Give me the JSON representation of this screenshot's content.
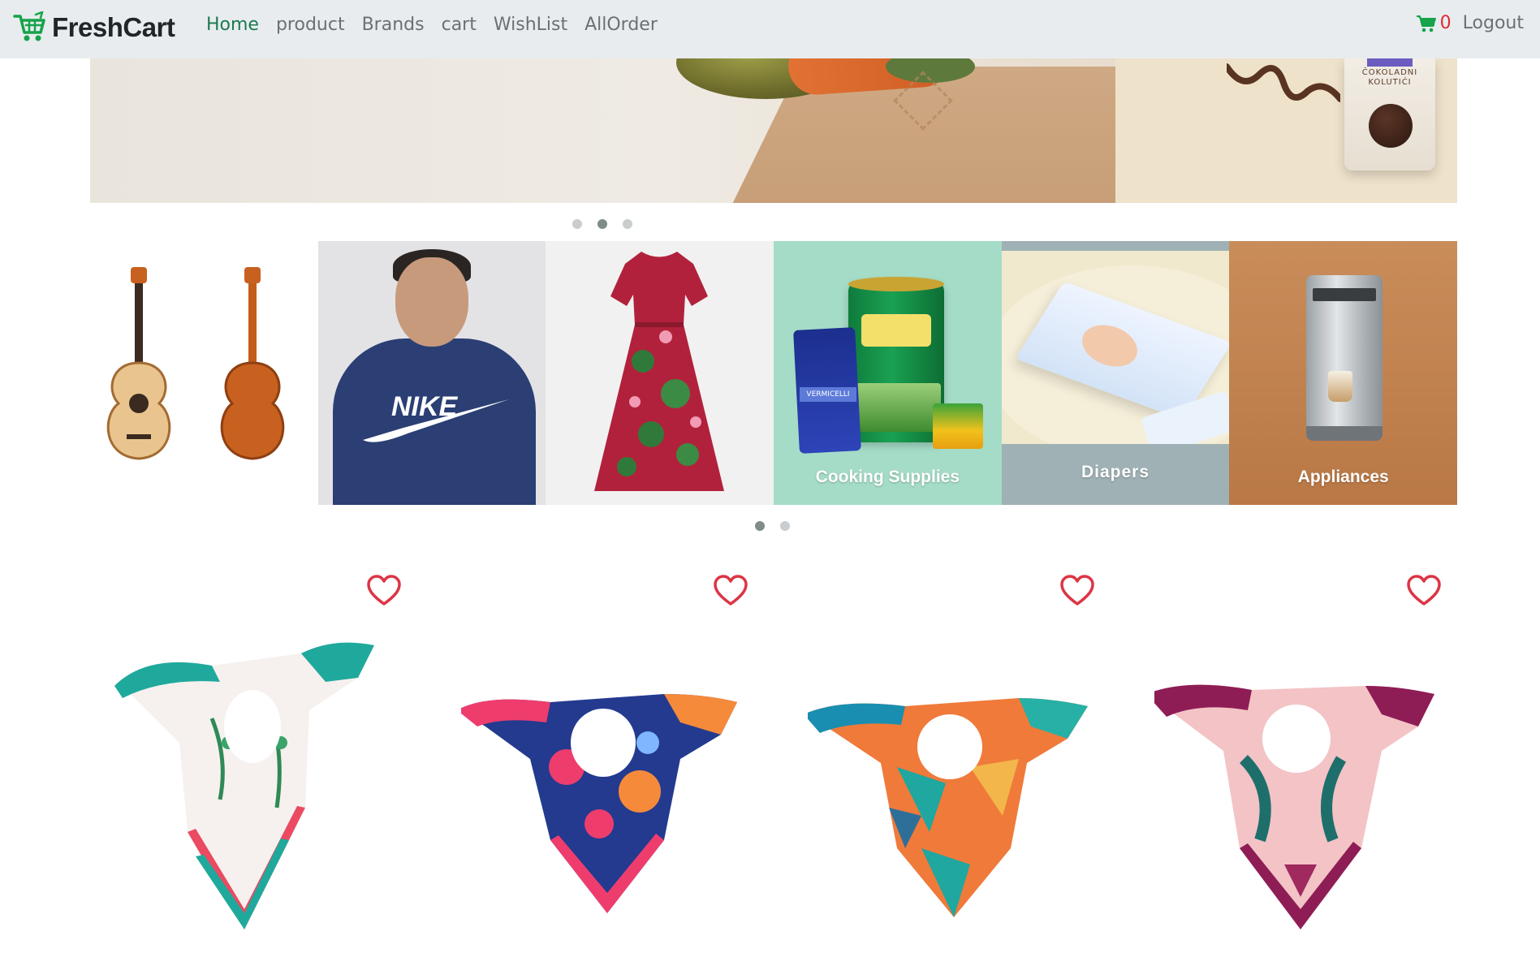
{
  "navbar": {
    "brand": "FreshCart",
    "links": [
      {
        "label": "Home",
        "active": true
      },
      {
        "label": "product",
        "active": false
      },
      {
        "label": "Brands",
        "active": false
      },
      {
        "label": "cart",
        "active": false
      },
      {
        "label": "WishList",
        "active": false
      },
      {
        "label": "AllOrder",
        "active": false
      }
    ],
    "cart_count": "0",
    "logout_label": "Logout",
    "icons": {
      "brand": "shopping-cart-icon",
      "cart": "shopping-cart-icon"
    }
  },
  "main_slider": {
    "slides": [
      {
        "name": "groceries-bag-banner",
        "visible_text": ""
      },
      {
        "name": "chocolate-cookies-banner",
        "visible_text": "ČOKOLADNI KOLUTIĆI"
      }
    ],
    "dots": 3,
    "active_dot": 1
  },
  "category_slider": {
    "categories": [
      {
        "label": ""
      },
      {
        "label": ""
      },
      {
        "label": ""
      },
      {
        "label": "Cooking Supplies"
      },
      {
        "label": "Diapers"
      },
      {
        "label": "Appliances"
      }
    ],
    "extra_text": {
      "pasta": "VERMICELLI",
      "hoodie": "NIKE"
    },
    "dots": 2,
    "active_dot": 0
  },
  "products": {
    "items": [
      {
        "name": "scarf-white-green-floral",
        "wishlisted": false
      },
      {
        "name": "scarf-navy-pink-abstract",
        "wishlisted": false
      },
      {
        "name": "scarf-teal-orange-geometric",
        "wishlisted": false
      },
      {
        "name": "scarf-burgundy-pink-leaves",
        "wishlisted": false
      }
    ],
    "wishlist_icon": "heart-outline-icon"
  },
  "colors": {
    "nav_bg": "#e8ecef",
    "brand_green": "#1b7a4e",
    "cart_green": "#16a34a",
    "cart_count_red": "#e02a34",
    "heart_red": "#dc3545"
  }
}
